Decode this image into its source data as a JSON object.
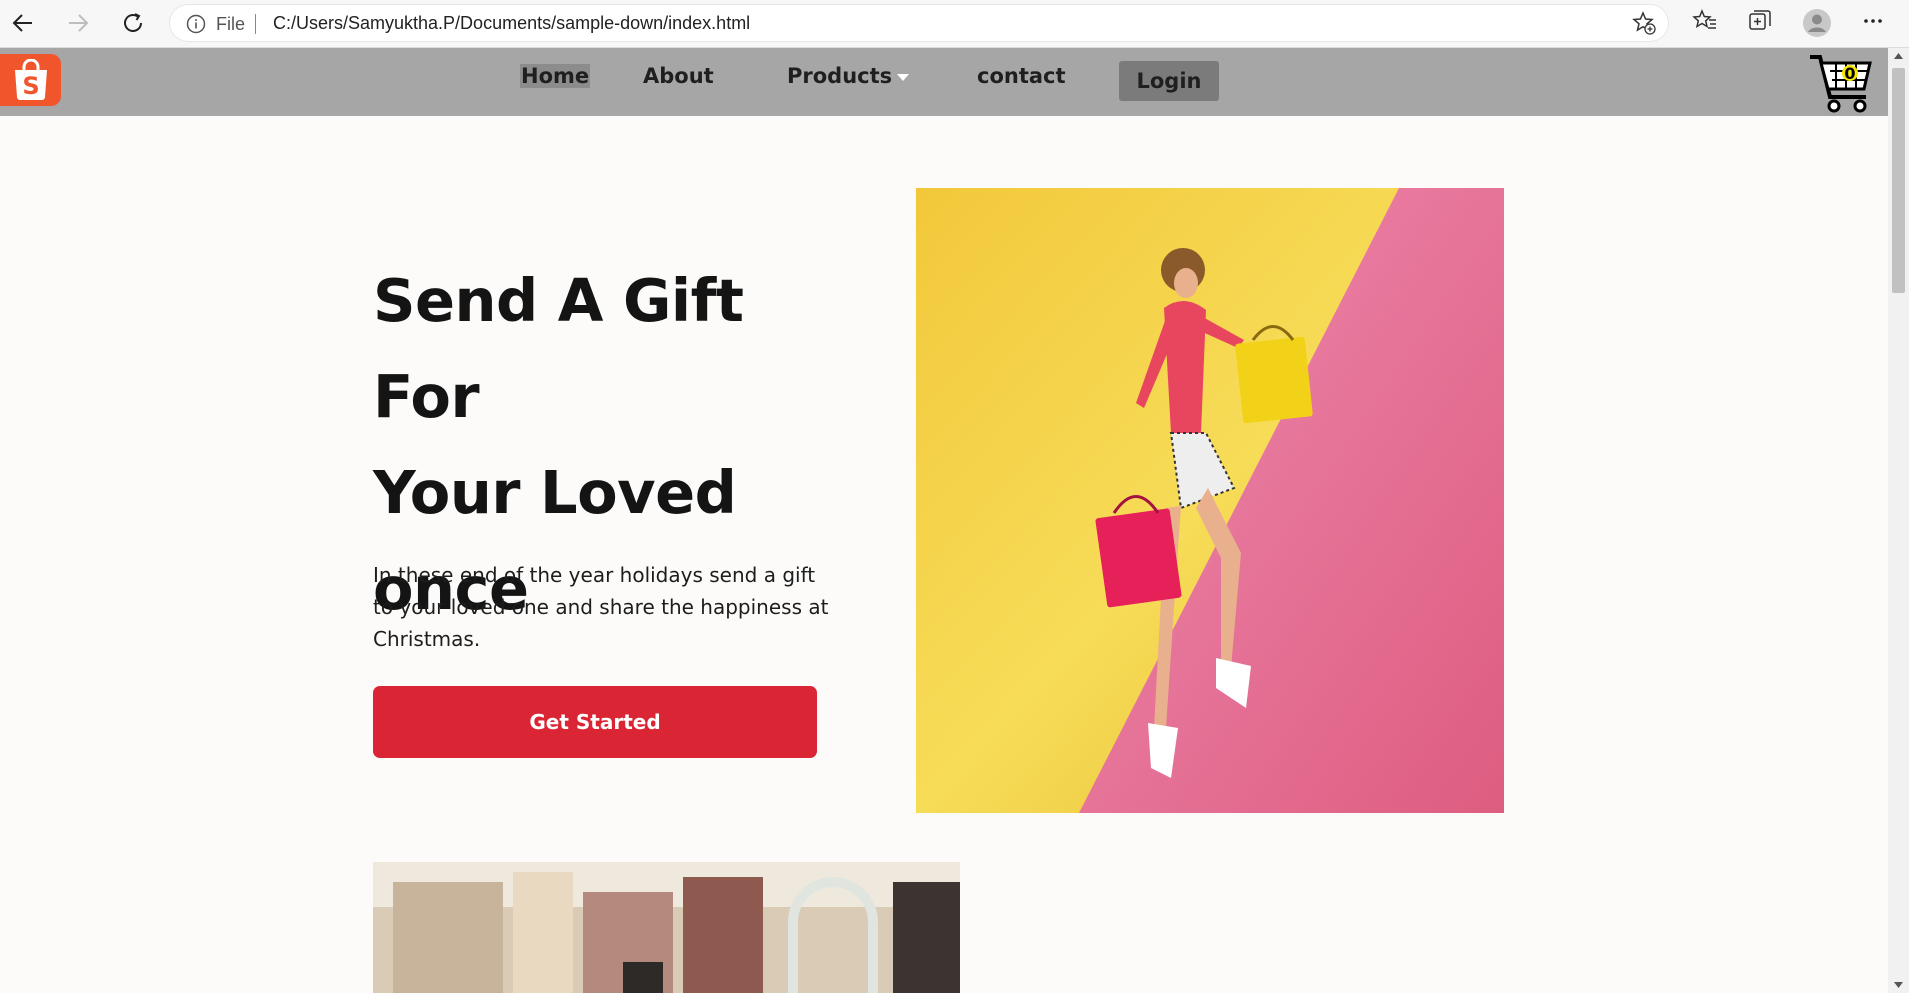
{
  "browser": {
    "file_label": "File",
    "url": "C:/Users/Samyuktha.P/Documents/sample-down/index.html"
  },
  "site": {
    "logo_letter": "S",
    "nav": [
      {
        "label": "Home"
      },
      {
        "label": "About"
      },
      {
        "label": "Products"
      },
      {
        "label": "contact"
      }
    ],
    "login_label": "Login",
    "cart_count": "0"
  },
  "hero": {
    "title_line1": "Send A Gift For",
    "title_line2": "Your Loved",
    "title_line3": "once",
    "text": "In these end of the year holidays send a gift to your loved one and share the happiness at Christmas.",
    "cta_label": "Get Started"
  },
  "colors": {
    "header_bg": "#a6a6a6",
    "cta": "#da2535",
    "logo": "#f0552b",
    "page_bg": "#fcfbfa"
  },
  "icons": [
    "back-icon",
    "forward-icon",
    "refresh-icon",
    "info-icon",
    "add-favorite-icon",
    "favorites-icon",
    "collections-icon",
    "profile-icon",
    "more-icon",
    "shopping-bag-icon",
    "cart-icon"
  ]
}
